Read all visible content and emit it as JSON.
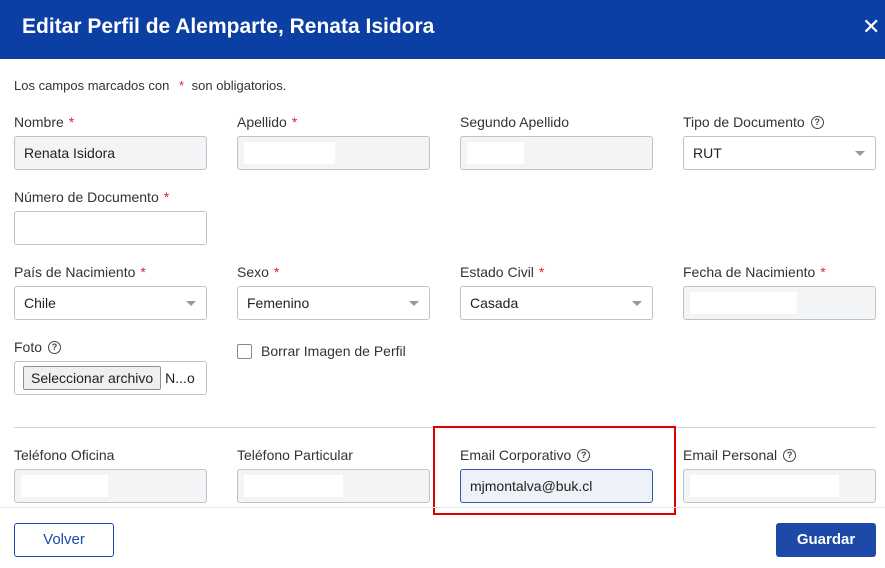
{
  "header": {
    "title": "Editar Perfil de Alemparte, Renata Isidora",
    "close_glyph": "✕"
  },
  "note": {
    "prefix": "Los campos marcados con",
    "asterisk": "*",
    "suffix": "son obligatorios."
  },
  "fields": {
    "nombre": {
      "label": "Nombre",
      "value": "Renata Isidora"
    },
    "apellido": {
      "label": "Apellido",
      "value": ""
    },
    "segundo_apellido": {
      "label": "Segundo Apellido",
      "value": ""
    },
    "tipo_documento": {
      "label": "Tipo de Documento",
      "value": "RUT"
    },
    "numero_documento": {
      "label": "Número de Documento",
      "value": ""
    },
    "pais_nacimiento": {
      "label": "País de Nacimiento",
      "value": "Chile"
    },
    "sexo": {
      "label": "Sexo",
      "value": "Femenino"
    },
    "estado_civil": {
      "label": "Estado Civil",
      "value": "Casada"
    },
    "fecha_nacimiento": {
      "label": "Fecha de Nacimiento",
      "value": ""
    },
    "foto": {
      "label": "Foto",
      "button": "Seleccionar archivo",
      "filename": "N...o"
    },
    "borrar_imagen": {
      "label": "Borrar Imagen de Perfil",
      "checked": false
    },
    "telefono_oficina": {
      "label": "Teléfono Oficina",
      "value": ""
    },
    "telefono_particular": {
      "label": "Teléfono Particular",
      "value": ""
    },
    "email_corporativo": {
      "label": "Email Corporativo",
      "value": "mjmontalva@buk.cl"
    },
    "email_personal": {
      "label": "Email Personal",
      "value": ""
    }
  },
  "required_mark": "*",
  "help_glyph": "?",
  "buttons": {
    "back": "Volver",
    "save": "Guardar"
  },
  "colors": {
    "header": "#0b3fa3",
    "primary": "#1d4aa8",
    "required": "#d9262b",
    "highlight": "#e00000"
  }
}
